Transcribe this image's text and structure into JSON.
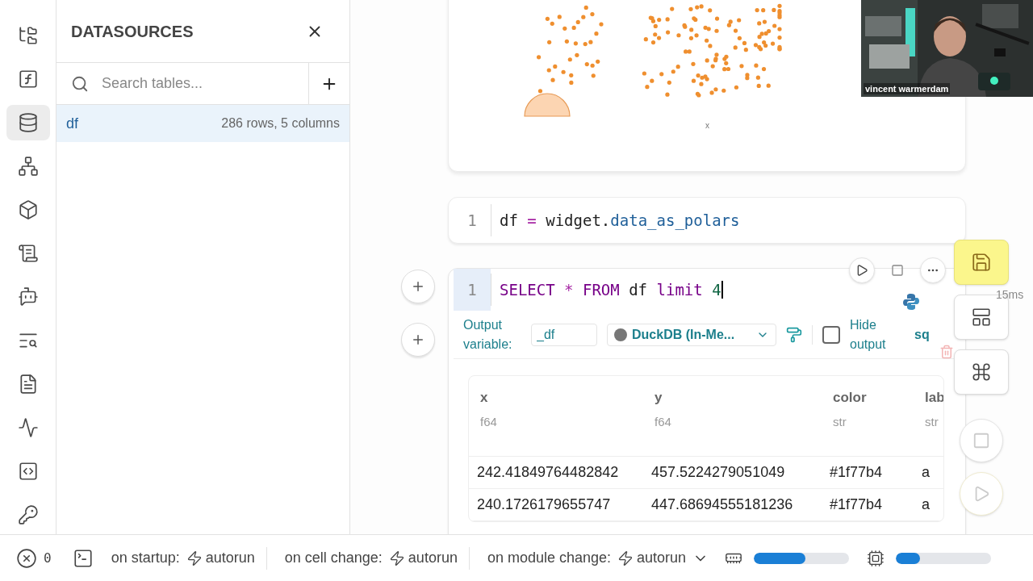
{
  "rail": [
    {
      "selected": false
    },
    {
      "selected": false
    },
    {
      "selected": true
    },
    {
      "selected": false
    },
    {
      "selected": false
    },
    {
      "selected": false
    },
    {
      "selected": false
    },
    {
      "selected": false
    },
    {
      "selected": false
    },
    {
      "selected": false
    },
    {
      "selected": false
    },
    {
      "selected": false
    }
  ],
  "sidebar": {
    "title": "DATASOURCES",
    "search": {
      "placeholder": "Search tables..."
    },
    "tables": [
      {
        "name": "df",
        "info": "286 rows, 5 columns",
        "selected": true
      }
    ]
  },
  "chart": {
    "axis_mark": "x"
  },
  "cells": [
    {
      "line": "1",
      "active": false,
      "tokens": [
        {
          "text": "df",
          "kind": "name"
        },
        {
          "text": " = ",
          "kind": "operator"
        },
        {
          "text": "widget",
          "kind": "name"
        },
        {
          "text": ".",
          "kind": "plain"
        },
        {
          "text": "data_as_polars",
          "kind": "property"
        }
      ]
    },
    {
      "line": "1",
      "active": true,
      "tokens": [
        {
          "text": "SELECT",
          "kind": "keyword"
        },
        {
          "text": " * ",
          "kind": "operator"
        },
        {
          "text": "FROM",
          "kind": "keyword"
        },
        {
          "text": " df ",
          "kind": "plain"
        },
        {
          "text": "limit",
          "kind": "keyword"
        },
        {
          "text": " 4",
          "kind": "number"
        }
      ],
      "timing": "15ms",
      "output": {
        "variable_label": "Output variable:",
        "variable": "_df",
        "engine": "DuckDB (In-Me...",
        "hide_output_label": "Hide output",
        "hide_output": false,
        "mode": "sq"
      },
      "table": {
        "columns": [
          {
            "name": "x",
            "type": "f64"
          },
          {
            "name": "y",
            "type": "f64"
          },
          {
            "name": "color",
            "type": "str"
          },
          {
            "name": "lab",
            "type": "str"
          }
        ],
        "rows": [
          [
            "242.41849764482842",
            "457.5224279051049",
            "#1f77b4",
            "a"
          ],
          [
            "240.1726179655747",
            "447.68694555181236",
            "#1f77b4",
            "a"
          ]
        ]
      }
    }
  ],
  "webcam": {
    "name": "vincent warmerdam"
  },
  "status_bar": {
    "errors": "0",
    "startup_label": "on startup:",
    "startup": "autorun",
    "cell_change_label": "on cell change:",
    "cell_change": "autorun",
    "module_change_label": "on module change:",
    "module_change": "autorun",
    "memory": {
      "level": 0.54
    },
    "cpu": {
      "level": 0.25
    }
  }
}
